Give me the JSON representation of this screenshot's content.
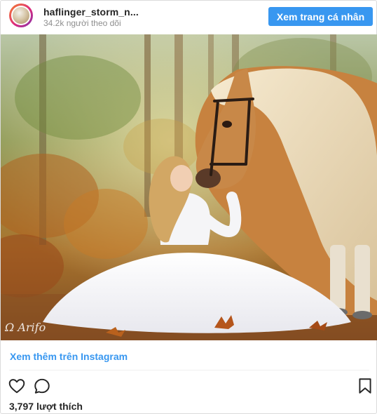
{
  "header": {
    "username": "haflinger_storm_n...",
    "followers": "34.2k người theo dõi",
    "view_profile_label": "Xem trang cá nhân"
  },
  "post": {
    "watermark": "Ω Arifo",
    "view_more_label": "Xem thêm trên Instagram",
    "likes_count": "3,797",
    "likes_label": "lượt thích"
  },
  "icons": {
    "like": "heart-icon",
    "comment": "comment-icon",
    "save": "bookmark-icon"
  },
  "colors": {
    "accent": "#3897f0",
    "text": "#262626",
    "muted": "#8e8e8e"
  }
}
